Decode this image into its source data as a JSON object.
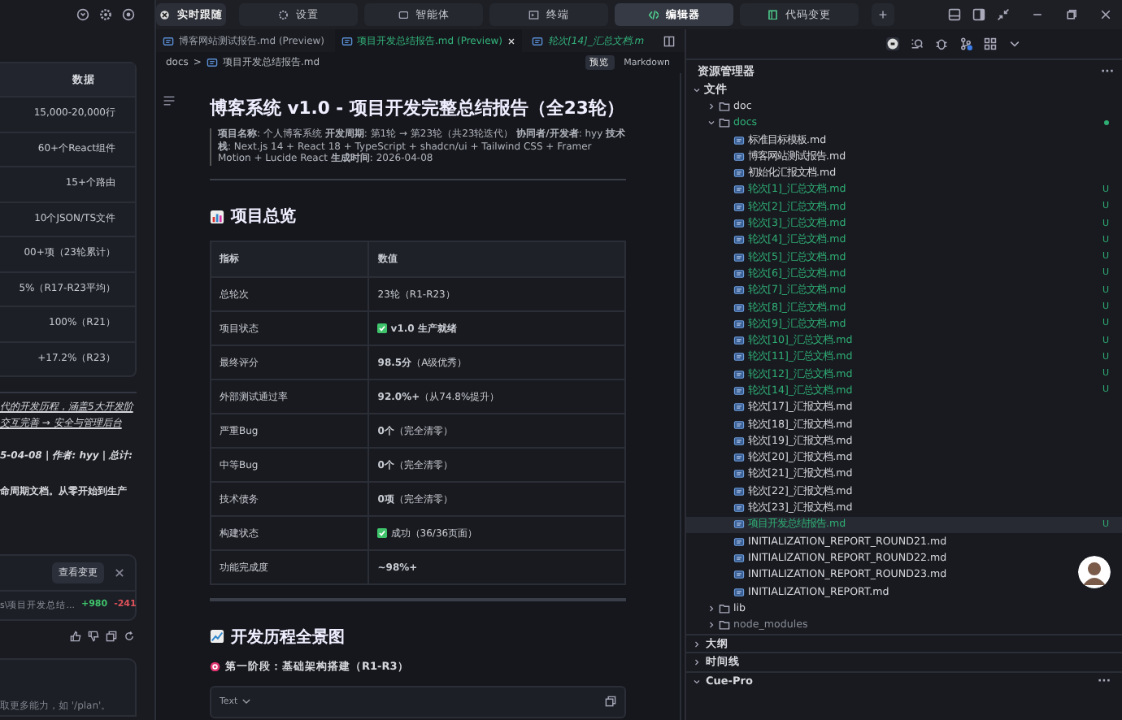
{
  "chat": {
    "table_header": "数据",
    "table_rows": [
      "15,000-20,000行",
      "60+个React组件",
      "15+个路由",
      "10个JSON/TS文件",
      "00+项（23轮累计）",
      "5%（R17-R23平均）",
      "100%（R21）",
      "+17.2%（R23）"
    ],
    "italic_lines": [
      "代的开发历程，涵盖5大开发阶",
      "交互完善 → 安全与管理后台"
    ],
    "meta_line": "5-04-08 | 作者: hyy | 总计:",
    "bold_line": "命周期文档。从零开始到生产",
    "change_card": {
      "button": "查看变更",
      "file": "s\\项目开发总结...",
      "added": "+980",
      "removed": "-241"
    },
    "input_placeholder": "取更多能力，如 '/plan'。"
  },
  "top_tabs": [
    {
      "label": "实时跟随",
      "selected": false
    },
    {
      "label": "设置",
      "selected": false
    },
    {
      "label": "智能体",
      "selected": false
    },
    {
      "label": "终端",
      "selected": false
    },
    {
      "label": "编辑器",
      "selected": true
    },
    {
      "label": "代码变更",
      "selected": false
    }
  ],
  "add_tab": "+",
  "editor_tabs": [
    {
      "label": "博客网站测试报告.md (Preview)",
      "selected": false,
      "italic": false,
      "untracked": false
    },
    {
      "label": "项目开发总结报告.md (Preview)",
      "selected": true,
      "italic": false,
      "untracked": true
    },
    {
      "label": "轮次[14]_汇总文档.m",
      "selected": false,
      "italic": true,
      "untracked": true
    }
  ],
  "breadcrumb": {
    "folder": "docs",
    "separator": ">",
    "file": "项目开发总结报告.md"
  },
  "view_modes": [
    {
      "label": "预览",
      "selected": true
    },
    {
      "label": "Markdown",
      "selected": false
    }
  ],
  "document": {
    "title": "博客系统 v1.0 - 项目开发完整总结报告（全23轮）",
    "meta": "**项目名称**: 个人博客系统 **开发周期**: 第1轮 → 第23轮（共23轮迭代） **协同者/开发者**: hyy **技术栈**: Next.js 14 + React 18 + TypeScript + shadcn/ui + Tailwind CSS + Framer Motion + Lucide React **生成时间**: 2026-04-08",
    "section_1": "项目总览",
    "table": {
      "columns": [
        "指标",
        "数值"
      ],
      "rows": [
        {
          "metric": "总轮次",
          "value": "23轮（R1-R23）",
          "check": false
        },
        {
          "metric": "项目状态",
          "value": "**v1.0 生产就绪**",
          "check": true
        },
        {
          "metric": "最终评分",
          "value": "**98.5分**（A级优秀）",
          "check": false
        },
        {
          "metric": "外部测试通过率",
          "value": "**92.0%+**（从74.8%提升）",
          "check": false
        },
        {
          "metric": "严重Bug",
          "value": "**0个**（完全清零）",
          "check": false
        },
        {
          "metric": "中等Bug",
          "value": "**0个**（完全清零）",
          "check": false
        },
        {
          "metric": "技术债务",
          "value": "**0项**（完全清零）",
          "check": false
        },
        {
          "metric": "构建状态",
          "value": "成功（36/36页面）",
          "check": true
        },
        {
          "metric": "功能完成度",
          "value": "**~98%+**",
          "check": false
        }
      ]
    },
    "section_2": "开发历程全景图",
    "subsection": "第一阶段：基础架构搭建（R1-R3）",
    "code_language": "Text"
  },
  "explorer": {
    "title": "资源管理器",
    "more": "···",
    "tree": [
      {
        "label": "文件",
        "kind": "root",
        "expanded": true,
        "selected": false,
        "children": [
          {
            "label": "doc",
            "kind": "folder",
            "expanded": false,
            "selected": false
          },
          {
            "label": "docs",
            "kind": "folder",
            "expanded": true,
            "selected": false,
            "modified": true,
            "children": [
              {
                "label": "标准目标模板.md",
                "kind": "file",
                "selected": false
              },
              {
                "label": "博客网站测试报告.md",
                "kind": "file",
                "selected": false
              },
              {
                "label": "初始化汇报文档.md",
                "kind": "file",
                "selected": false
              },
              {
                "label": "轮次[1]_汇总文档.md",
                "kind": "file",
                "selected": false,
                "git_status": "U"
              },
              {
                "label": "轮次[2]_汇总文档.md",
                "kind": "file",
                "selected": false,
                "git_status": "U"
              },
              {
                "label": "轮次[3]_汇总文档.md",
                "kind": "file",
                "selected": false,
                "git_status": "U"
              },
              {
                "label": "轮次[4]_汇总文档.md",
                "kind": "file",
                "selected": false,
                "git_status": "U"
              },
              {
                "label": "轮次[5]_汇总文档.md",
                "kind": "file",
                "selected": false,
                "git_status": "U"
              },
              {
                "label": "轮次[6]_汇总文档.md",
                "kind": "file",
                "selected": false,
                "git_status": "U"
              },
              {
                "label": "轮次[7]_汇总文档.md",
                "kind": "file",
                "selected": false,
                "git_status": "U"
              },
              {
                "label": "轮次[8]_汇总文档.md",
                "kind": "file",
                "selected": false,
                "git_status": "U"
              },
              {
                "label": "轮次[9]_汇总文档.md",
                "kind": "file",
                "selected": false,
                "git_status": "U"
              },
              {
                "label": "轮次[10]_汇总文档.md",
                "kind": "file",
                "selected": false,
                "git_status": "U"
              },
              {
                "label": "轮次[11]_汇总文档.md",
                "kind": "file",
                "selected": false,
                "git_status": "U"
              },
              {
                "label": "轮次[12]_汇总文档.md",
                "kind": "file",
                "selected": false,
                "git_status": "U"
              },
              {
                "label": "轮次[14]_汇总文档.md",
                "kind": "file",
                "selected": false,
                "git_status": "U"
              },
              {
                "label": "轮次[17]_汇报文档.md",
                "kind": "file",
                "selected": false
              },
              {
                "label": "轮次[18]_汇报文档.md",
                "kind": "file",
                "selected": false
              },
              {
                "label": "轮次[19]_汇报文档.md",
                "kind": "file",
                "selected": false
              },
              {
                "label": "轮次[20]_汇报文档.md",
                "kind": "file",
                "selected": false
              },
              {
                "label": "轮次[21]_汇报文档.md",
                "kind": "file",
                "selected": false
              },
              {
                "label": "轮次[22]_汇报文档.md",
                "kind": "file",
                "selected": false
              },
              {
                "label": "轮次[23]_汇报文档.md",
                "kind": "file",
                "selected": false
              },
              {
                "label": "项目开发总结报告.md",
                "kind": "file",
                "selected": true,
                "git_status": "U"
              },
              {
                "label": "INITIALIZATION_REPORT_ROUND21.md",
                "kind": "file",
                "selected": false
              },
              {
                "label": "INITIALIZATION_REPORT_ROUND22.md",
                "kind": "file",
                "selected": false
              },
              {
                "label": "INITIALIZATION_REPORT_ROUND23.md",
                "kind": "file",
                "selected": false
              },
              {
                "label": "INITIALIZATION_REPORT.md",
                "kind": "file",
                "selected": false
              }
            ]
          },
          {
            "label": "lib",
            "kind": "folder",
            "expanded": false,
            "selected": false
          },
          {
            "label": "node_modules",
            "kind": "folder",
            "expanded": false,
            "selected": false,
            "ignored": true
          }
        ]
      }
    ],
    "sections": [
      {
        "label": "大纲",
        "expanded": false
      },
      {
        "label": "时间线",
        "expanded": false
      },
      {
        "label": "Cue-Pro",
        "expanded": true,
        "more": "···"
      }
    ]
  }
}
